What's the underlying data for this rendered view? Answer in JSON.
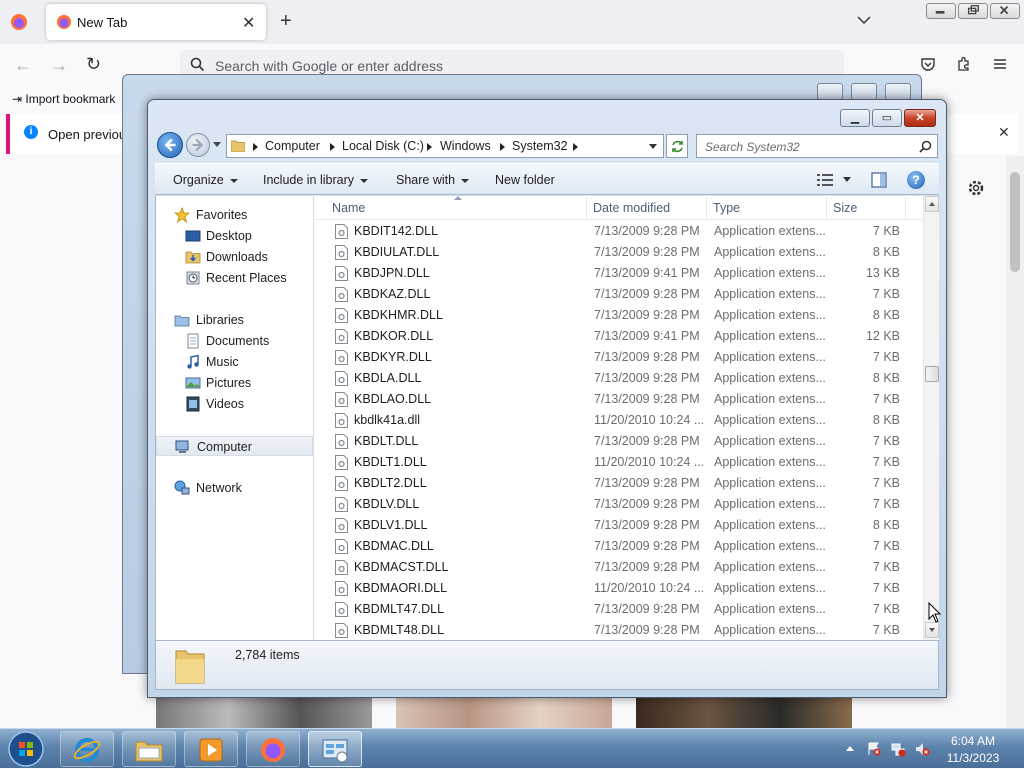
{
  "browser": {
    "tab_title": "New Tab",
    "url_placeholder": "Search with Google or enter address",
    "bookmark_import": "Import bookmark",
    "notice_text": "Open previous"
  },
  "explorer": {
    "breadcrumb": [
      "Computer",
      "Local Disk (C:)",
      "Windows",
      "System32"
    ],
    "search_placeholder": "Search System32",
    "toolbar": {
      "organize": "Organize",
      "include": "Include in library",
      "share": "Share with",
      "new_folder": "New folder"
    },
    "nav": {
      "favorites": "Favorites",
      "desktop": "Desktop",
      "downloads": "Downloads",
      "recent": "Recent Places",
      "libraries": "Libraries",
      "documents": "Documents",
      "music": "Music",
      "pictures": "Pictures",
      "videos": "Videos",
      "computer": "Computer",
      "network": "Network"
    },
    "columns": {
      "name": "Name",
      "date": "Date modified",
      "type": "Type",
      "size": "Size"
    },
    "files": [
      {
        "name": "KBDIT142.DLL",
        "date": "7/13/2009 9:28 PM",
        "type": "Application extens...",
        "size": "7 KB"
      },
      {
        "name": "KBDIULAT.DLL",
        "date": "7/13/2009 9:28 PM",
        "type": "Application extens...",
        "size": "8 KB"
      },
      {
        "name": "KBDJPN.DLL",
        "date": "7/13/2009 9:41 PM",
        "type": "Application extens...",
        "size": "13 KB"
      },
      {
        "name": "KBDKAZ.DLL",
        "date": "7/13/2009 9:28 PM",
        "type": "Application extens...",
        "size": "7 KB"
      },
      {
        "name": "KBDKHMR.DLL",
        "date": "7/13/2009 9:28 PM",
        "type": "Application extens...",
        "size": "8 KB"
      },
      {
        "name": "KBDKOR.DLL",
        "date": "7/13/2009 9:41 PM",
        "type": "Application extens...",
        "size": "12 KB"
      },
      {
        "name": "KBDKYR.DLL",
        "date": "7/13/2009 9:28 PM",
        "type": "Application extens...",
        "size": "7 KB"
      },
      {
        "name": "KBDLA.DLL",
        "date": "7/13/2009 9:28 PM",
        "type": "Application extens...",
        "size": "8 KB"
      },
      {
        "name": "KBDLAO.DLL",
        "date": "7/13/2009 9:28 PM",
        "type": "Application extens...",
        "size": "7 KB"
      },
      {
        "name": "kbdlk41a.dll",
        "date": "11/20/2010 10:24 ...",
        "type": "Application extens...",
        "size": "8 KB"
      },
      {
        "name": "KBDLT.DLL",
        "date": "7/13/2009 9:28 PM",
        "type": "Application extens...",
        "size": "7 KB"
      },
      {
        "name": "KBDLT1.DLL",
        "date": "11/20/2010 10:24 ...",
        "type": "Application extens...",
        "size": "7 KB"
      },
      {
        "name": "KBDLT2.DLL",
        "date": "7/13/2009 9:28 PM",
        "type": "Application extens...",
        "size": "7 KB"
      },
      {
        "name": "KBDLV.DLL",
        "date": "7/13/2009 9:28 PM",
        "type": "Application extens...",
        "size": "7 KB"
      },
      {
        "name": "KBDLV1.DLL",
        "date": "7/13/2009 9:28 PM",
        "type": "Application extens...",
        "size": "8 KB"
      },
      {
        "name": "KBDMAC.DLL",
        "date": "7/13/2009 9:28 PM",
        "type": "Application extens...",
        "size": "7 KB"
      },
      {
        "name": "KBDMACST.DLL",
        "date": "7/13/2009 9:28 PM",
        "type": "Application extens...",
        "size": "7 KB"
      },
      {
        "name": "KBDMAORI.DLL",
        "date": "11/20/2010 10:24 ...",
        "type": "Application extens...",
        "size": "7 KB"
      },
      {
        "name": "KBDMLT47.DLL",
        "date": "7/13/2009 9:28 PM",
        "type": "Application extens...",
        "size": "7 KB"
      },
      {
        "name": "KBDMLT48.DLL",
        "date": "7/13/2009 9:28 PM",
        "type": "Application extens...",
        "size": "7 KB"
      }
    ],
    "item_count": "2,784 items"
  },
  "taskbar": {
    "time": "6:04 AM",
    "date": "11/3/2023"
  },
  "colors": {
    "accent": "#2466b8",
    "taskbar": "#5d84ad",
    "notice_border": "#e0137e"
  }
}
